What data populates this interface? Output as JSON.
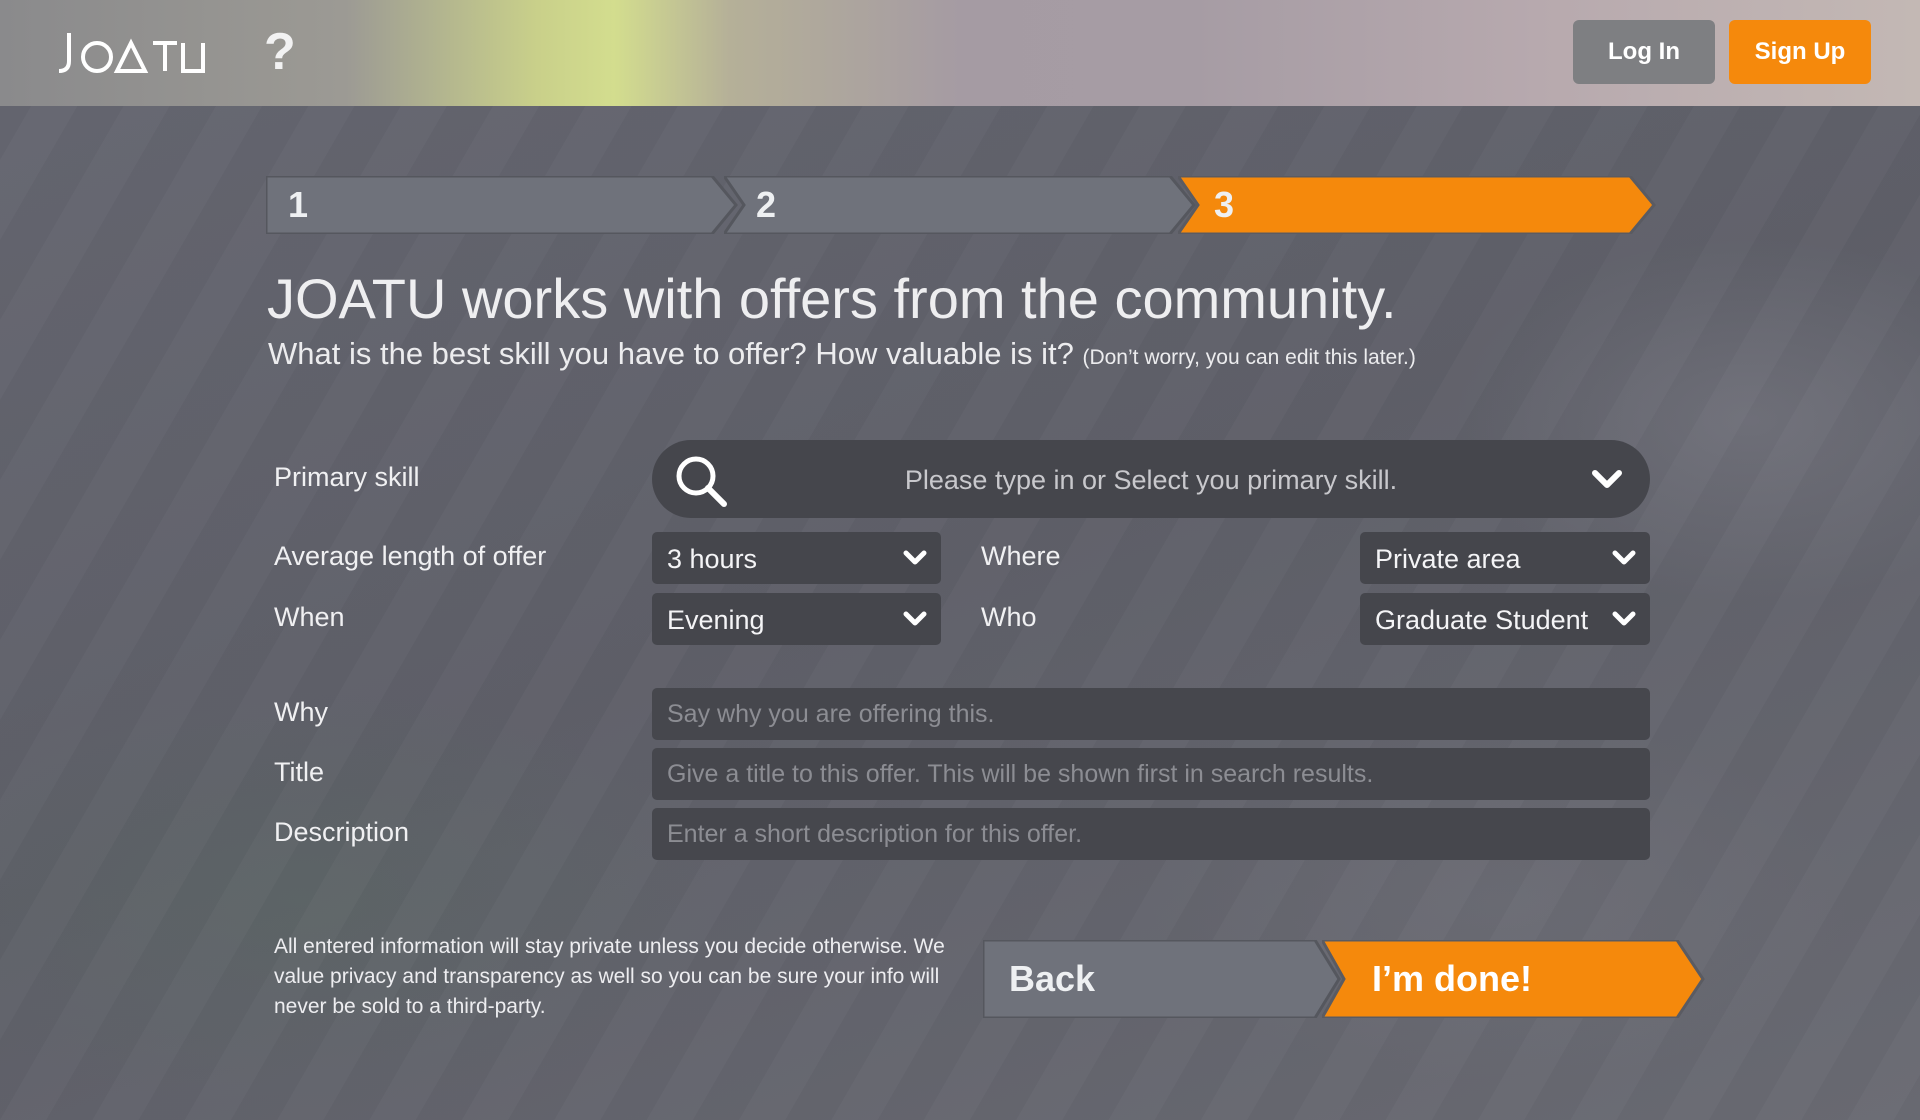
{
  "header": {
    "logo": "JOATU",
    "help_icon": "?",
    "login_label": "Log In",
    "signup_label": "Sign Up"
  },
  "steps": [
    {
      "label": "1",
      "active": false
    },
    {
      "label": "2",
      "active": false
    },
    {
      "label": "3",
      "active": true
    }
  ],
  "heading": {
    "title": "JOATU works with offers from the community.",
    "subtitle": "What is the best skill you have to offer? How valuable is it?",
    "note": "(Don’t worry, you can edit this later.)"
  },
  "form": {
    "primary_skill": {
      "label": "Primary skill",
      "placeholder": "Please type in or Select you primary skill."
    },
    "length": {
      "label": "Average length of offer",
      "value": "3 hours"
    },
    "where": {
      "label": "Where",
      "value": "Private area"
    },
    "when": {
      "label": "When",
      "value": "Evening"
    },
    "who": {
      "label": "Who",
      "value": "Graduate Student"
    },
    "why": {
      "label": "Why",
      "placeholder": "Say why you are offering this."
    },
    "title": {
      "label": "Title",
      "placeholder": "Give a title to this offer. This will be shown first in search results."
    },
    "description": {
      "label": "Description",
      "placeholder": "Enter a short description for this offer."
    }
  },
  "footer": {
    "privacy": "All entered information will stay private unless you decide otherwise. We value privacy and transparency as well so you can be sure your info will never be sold to a third-party.",
    "back_label": "Back",
    "done_label": "I’m done!"
  },
  "colors": {
    "accent": "#f5890c",
    "inactive_step": "#6f727b",
    "field_bg": "#45464c"
  }
}
